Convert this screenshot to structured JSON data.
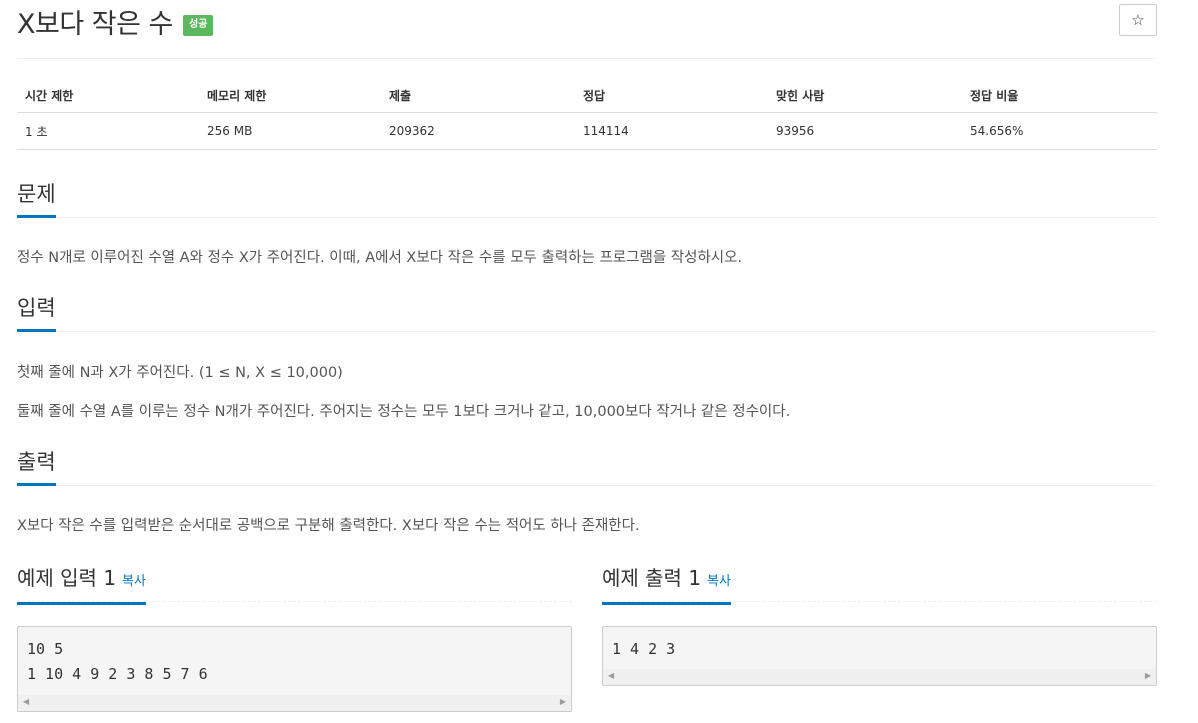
{
  "problem": {
    "title": "X보다 작은 수",
    "badge": "성공",
    "star_icon": "☆"
  },
  "info_table": {
    "headers": [
      "시간 제한",
      "메모리 제한",
      "제출",
      "정답",
      "맞힌 사람",
      "정답 비율"
    ],
    "values": [
      "1 초",
      "256 MB",
      "209362",
      "114114",
      "93956",
      "54.656%"
    ]
  },
  "sections": {
    "description": {
      "title": "문제",
      "text": "정수 N개로 이루어진 수열 A와 정수 X가 주어진다. 이때, A에서 X보다 작은 수를 모두 출력하는 프로그램을 작성하시오."
    },
    "input": {
      "title": "입력",
      "lines": [
        "첫째 줄에 N과 X가 주어진다. (1 ≤ N, X ≤ 10,000)",
        "둘째 줄에 수열 A를 이루는 정수 N개가 주어진다. 주어지는 정수는 모두 1보다 크거나 같고, 10,000보다 작거나 같은 정수이다."
      ]
    },
    "output": {
      "title": "출력",
      "text": "X보다 작은 수를 입력받은 순서대로 공백으로 구분해 출력한다. X보다 작은 수는 적어도 하나 존재한다."
    }
  },
  "samples": {
    "input": {
      "title": "예제 입력 1",
      "copy_label": "복사",
      "text": "10 5\n1 10 4 9 2 3 8 5 7 6"
    },
    "output": {
      "title": "예제 출력 1",
      "copy_label": "복사",
      "text": "1 4 2 3"
    }
  },
  "scroll_arrows": {
    "left": "◀",
    "right": "▶"
  },
  "colors": {
    "accent": "#0076c0",
    "badge_success": "#5cb85c"
  }
}
